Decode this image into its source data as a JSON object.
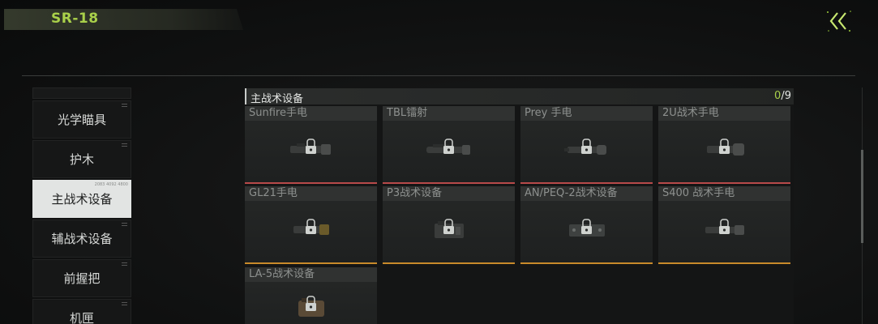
{
  "header": {
    "title": "SR-18"
  },
  "categories": [
    {
      "label": "光学瞄具"
    },
    {
      "label": "护木"
    },
    {
      "label": "主战术设备",
      "active": true,
      "badge": "2083 4092 4800"
    },
    {
      "label": "辅战术设备"
    },
    {
      "label": "前握把"
    },
    {
      "label": "机匣"
    }
  ],
  "panel": {
    "title": "主战术设备",
    "count_current": "0",
    "count_sep": "/",
    "count_total": "9"
  },
  "items": [
    {
      "name": "Sunfire手电",
      "icon": "flashlight-icon",
      "status": "red"
    },
    {
      "name": "TBL镭射",
      "icon": "laser-icon",
      "status": "red"
    },
    {
      "name": "Prey 手电",
      "icon": "flashlight-icon",
      "status": "red"
    },
    {
      "name": "2U战术手电",
      "icon": "flashlight-icon",
      "status": "red"
    },
    {
      "name": "GL21手电",
      "icon": "flashlight-icon",
      "status": "orange"
    },
    {
      "name": "P3战术设备",
      "icon": "laser-box-icon",
      "status": "orange"
    },
    {
      "name": "AN/PEQ-2战术设备",
      "icon": "laser-box-icon",
      "status": "orange"
    },
    {
      "name": "S400 战术手电",
      "icon": "flashlight-icon",
      "status": "orange"
    },
    {
      "name": "LA-5战术设备",
      "icon": "laser-box-icon",
      "status": "none"
    }
  ],
  "colors": {
    "accent": "#a9d04a",
    "status_red": "#b84a4a",
    "status_orange": "#c98a2a"
  }
}
